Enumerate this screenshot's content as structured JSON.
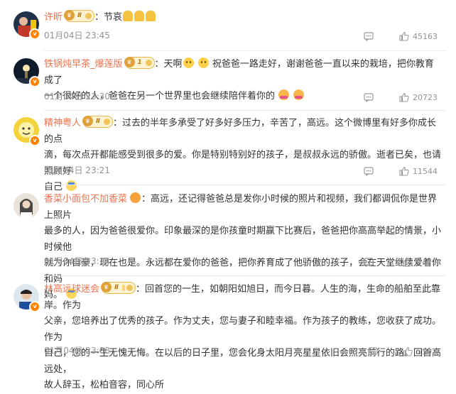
{
  "colors": {
    "username": "#eb7350",
    "meta": "#939393",
    "text": "#333333",
    "vip_badge": "#ff8200"
  },
  "comments": [
    {
      "user": "许昕",
      "level": "Ⅱ",
      "body": "：节哀",
      "emoji": [
        "pray-emoji",
        "pray-emoji",
        "pray-emoji"
      ],
      "date": "01月04日 23:45",
      "likes": "45163"
    },
    {
      "user": "铁锅炖早茶_爆莲版",
      "level": "1",
      "body_pre": "：天啊",
      "body_post": "祝爸爸一路走好，谢谢爸爸一直以来的栽培，把你教育成了",
      "body_line2": "一个很好的人，爸爸在另一个世界里也会继续陪伴着你的",
      "date": "01月04日 23:30",
      "likes": "20723"
    },
    {
      "user": "精神粤人",
      "level": "Ⅱ",
      "body_line1": "：过去的半年多承受了好多好多压力，辛苦了，高远。这个微博里有好多你成长的点",
      "body_line2": "滴，每次点开都能感受到很多的爱。你是特别特别好的孩子，是叔叔永远的骄傲。逝者已矣，也请照顾好",
      "body_line3": "自己",
      "date": "01月04日 23:21",
      "likes": "11544"
    },
    {
      "user": "香菜小面包不加香菜",
      "body_line1": "：高远，还记得爸爸总是发你小时候的照片和视频，我们都调侃你是世界上照片",
      "body_line2": "最多的人，因为爸爸很爱你。印象最深的是你孩童时期赢下比赛后，爸爸把你高高举起的情景，小时候他",
      "body_line3": "就为你自豪，现在也是。永远都在爱你的爸爸，把你养育成了他骄傲的孩子，会在天堂继续爱着你和妈",
      "body_line4": "妈。",
      "date": "01月04日 23:14",
      "likes": "7479"
    },
    {
      "user": "林高远球迷会",
      "level": "Ⅱ",
      "body_line1": "：回首您的一生，如朝阳如旭日，而今日暮。人生的海，生命的船舶至此靠岸。作为",
      "body_line2": "父亲，您培养出了优秀的孩子。作为丈夫，您与妻子和睦幸福。作为孩子的教练，您收获了成功。作为",
      "body_line3": "自己，您的一生无愧无悔。在以后的日子里，您会化身太阳月亮星星依旧会照亮前行的路。回首高远处，",
      "body_line4": "故人辞玉，松柏音容，同心所",
      "date": "01月04日 23:08",
      "likes": "5502"
    }
  ]
}
